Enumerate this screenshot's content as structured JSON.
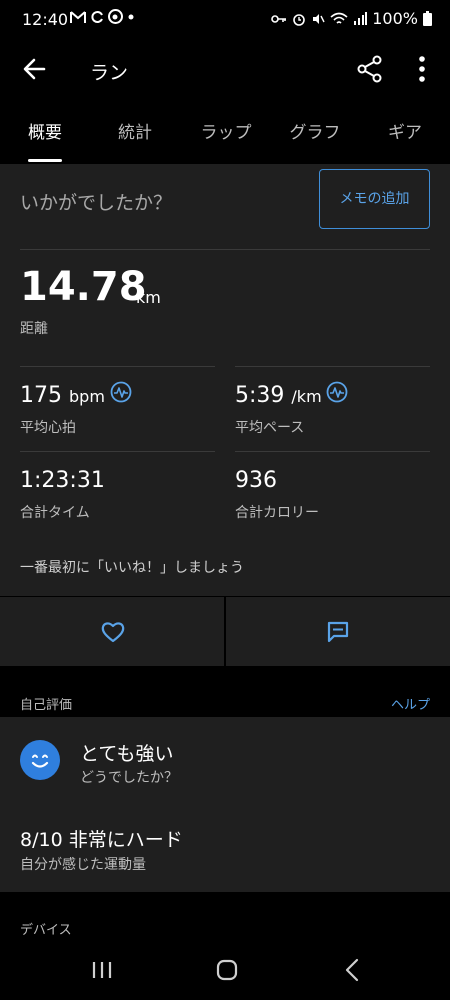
{
  "status_bar": {
    "time": "12:40",
    "left_icons": [
      "gmail-icon",
      "sync-icon",
      "app-d-icon",
      "dot-icon"
    ],
    "right_icons": [
      "key-icon",
      "alarm-icon",
      "mute-icon",
      "wifi-icon",
      "signal-icon"
    ],
    "battery": "100%"
  },
  "app_bar": {
    "title": "ラン"
  },
  "tabs": [
    {
      "label": "概要",
      "active": true
    },
    {
      "label": "統計",
      "active": false
    },
    {
      "label": "ラップ",
      "active": false
    },
    {
      "label": "グラフ",
      "active": false
    },
    {
      "label": "ギア",
      "active": false
    }
  ],
  "summary": {
    "feeling_question": "いかがでしたか？",
    "memo_button": "メモの追加",
    "distance": {
      "value": "14.78",
      "unit": "km",
      "label": "距離"
    },
    "avg_heart_rate": {
      "value": "175",
      "unit": "bpm",
      "label": "平均心拍"
    },
    "avg_pace": {
      "value": "5:39",
      "unit": "/km",
      "label": "平均ペース"
    },
    "total_time": {
      "value": "1:23:31",
      "label": "合計タイム"
    },
    "total_calories": {
      "value": "936",
      "label": "合計カロリー"
    },
    "like_prompt": "一番最初に「いいね！」しましょう"
  },
  "self_eval": {
    "section_title": "自己評価",
    "help_link": "ヘルプ",
    "feeling_title": "とても強い",
    "feeling_sub": "どうでしたか？",
    "effort_title": "8/10 非常にハード",
    "effort_sub": "自分が感じた運動量"
  },
  "devices": {
    "section_title": "デバイス"
  },
  "colors": {
    "accent": "#5aa3e8",
    "card_bg": "#1f1f1f",
    "background": "#000000",
    "smiley": "#2f7fde"
  }
}
